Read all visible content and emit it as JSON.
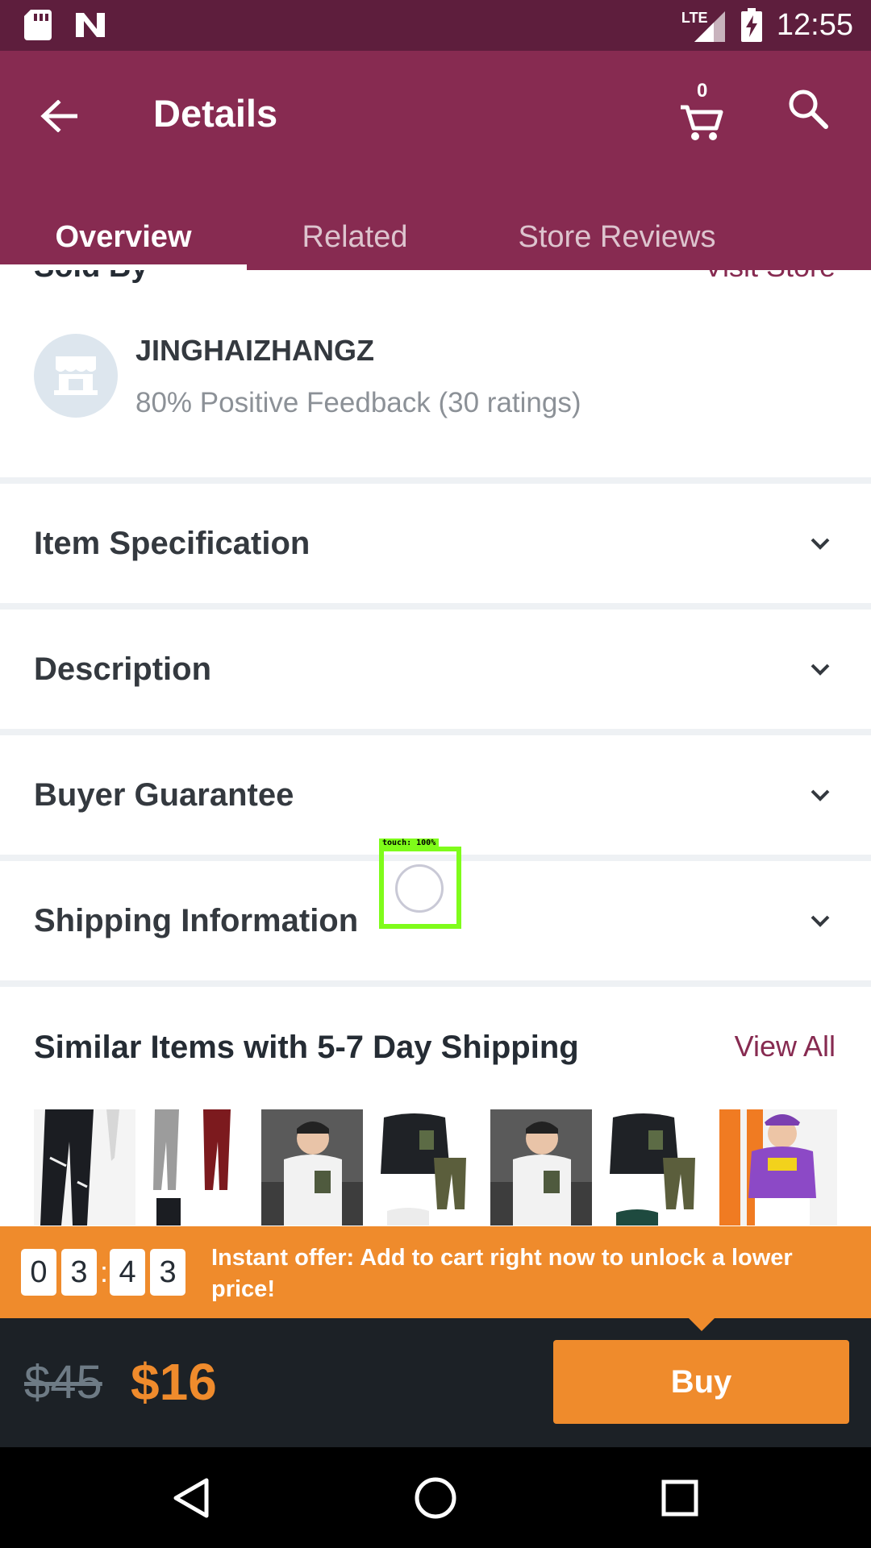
{
  "status_bar": {
    "time": "12:55",
    "network": "LTE",
    "icons": [
      "sd-card-icon",
      "n-notification-icon",
      "signal-icon",
      "battery-charging-icon"
    ]
  },
  "app_bar": {
    "title": "Details",
    "cart_count": "0",
    "icons": [
      "back-arrow-icon",
      "cart-icon",
      "search-icon"
    ]
  },
  "tabs": [
    {
      "label": "Overview",
      "active": true
    },
    {
      "label": "Related",
      "active": false
    },
    {
      "label": "Store Reviews",
      "active": false
    }
  ],
  "seller": {
    "section_title": "Sold By",
    "visit_store_label": "Visit Store",
    "name": "JINGHAIZHANGZ",
    "feedback": "80% Positive Feedback (30 ratings)"
  },
  "sections": [
    {
      "label": "Item Specification"
    },
    {
      "label": "Description"
    },
    {
      "label": "Buyer Guarantee"
    },
    {
      "label": "Shipping Information"
    }
  ],
  "similar": {
    "title": "Similar Items with 5-7 Day Shipping",
    "view_all_label": "View All"
  },
  "touch_indicator": {
    "label": "touch: 100%"
  },
  "offer": {
    "digits": [
      "0",
      "3",
      "4",
      "3"
    ],
    "separator": ":",
    "text": "Instant offer: Add to cart right now to unlock a lower price!"
  },
  "price": {
    "old": "$45",
    "new": "$16",
    "buy_label": "Buy"
  },
  "colors": {
    "brand": "#872b51",
    "status_bar": "#5e1e3d",
    "accent": "#ef8b2c",
    "bottom_bar": "#1c2126"
  }
}
